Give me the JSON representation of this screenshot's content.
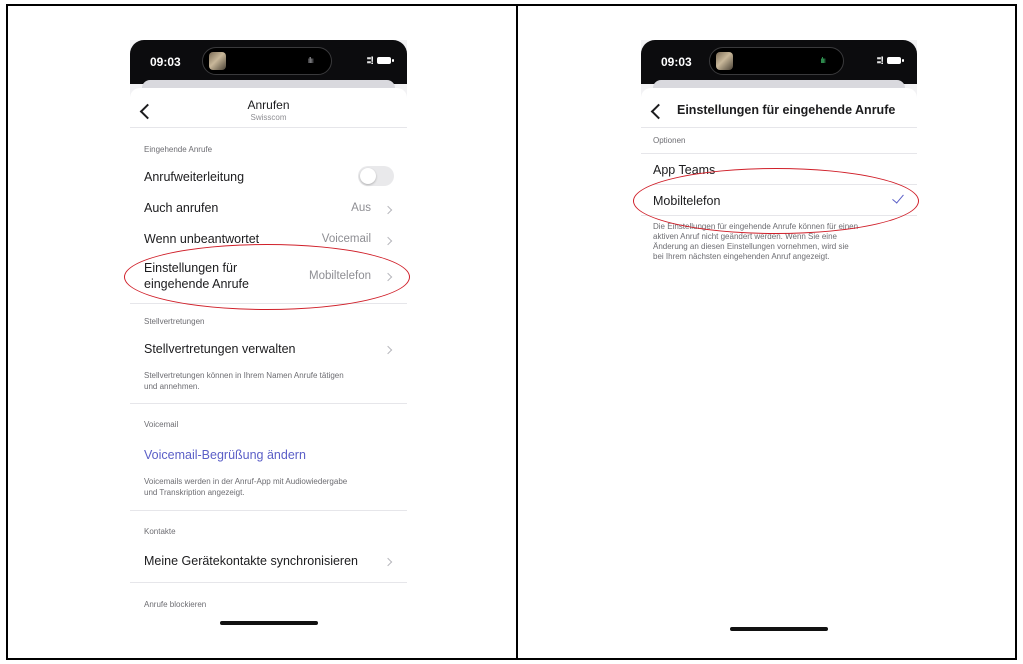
{
  "left_phone": {
    "status_time": "09:03",
    "signal": "∶∶!",
    "nav": {
      "title": "Anrufen",
      "subtitle": "Swisscom"
    },
    "sections": {
      "incoming": "Eingehende Anrufe",
      "delegates": "Stellvertretungen",
      "voicemail": "Voicemail",
      "contacts": "Kontakte",
      "block": "Anrufe blockieren"
    },
    "rows": {
      "forwarding": {
        "label": "Anrufweiterleitung",
        "toggle_on": false
      },
      "also_ring": {
        "label": "Auch anrufen",
        "value": "Aus"
      },
      "unanswered": {
        "label": "Wenn unbeantwortet",
        "value": "Voicemail"
      },
      "incoming_settings": {
        "label_line1": "Einstellungen für",
        "label_line2": "eingehende Anrufe",
        "value": "Mobiltelefon"
      },
      "manage_delegates": {
        "label": "Stellvertretungen verwalten"
      },
      "voicemail_greeting": {
        "label": "Voicemail-Begrüßung ändern"
      },
      "sync_contacts": {
        "label": "Meine Gerätekontakte synchronisieren"
      }
    },
    "notes": {
      "delegates_line1": "Stellvertretungen können in Ihrem Namen Anrufe tätigen",
      "delegates_line2": "und annehmen.",
      "voicemail_line1": "Voicemails werden in der Anruf-App mit Audiowiedergabe",
      "voicemail_line2": "und Transkription angezeigt."
    }
  },
  "right_phone": {
    "status_time": "09:03",
    "signal": "∶∶!",
    "nav": {
      "title": "Einstellungen für eingehende Anrufe"
    },
    "section": "Optionen",
    "options": [
      {
        "label": "App Teams",
        "selected": false
      },
      {
        "label": "Mobiltelefon",
        "selected": true
      }
    ],
    "note_lines": [
      "Die Einstellungen für eingehende Anrufe können für einen",
      "aktiven Anruf nicht geändert werden. Wenn Sie eine",
      "Änderung an diesen Einstellungen vornehmen, wird sie",
      "bei Ihrem nächsten eingehenden Anruf angezeigt."
    ]
  },
  "colors": {
    "accent": "#5b5fc7",
    "annotation": "#d0202a"
  }
}
